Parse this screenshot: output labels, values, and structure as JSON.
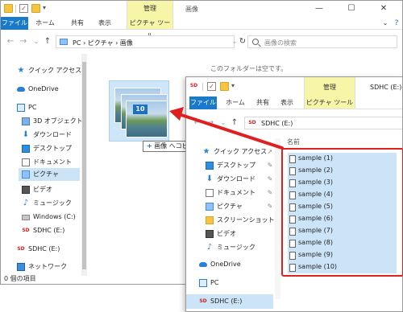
{
  "back_window": {
    "title": "画像",
    "manage_tab": "管理",
    "ribbon_tabs": [
      "ファイル",
      "ホーム",
      "共有",
      "表示",
      "ピクチャ ツール"
    ],
    "address": "PC › ピクチャ › 画像",
    "search_placeholder": "画像の検索",
    "empty_message": "このフォルダーは空です。",
    "status": "0 個の項目",
    "nav": [
      {
        "label": "クイック アクセス",
        "icon": "star-icon"
      },
      {
        "label": "OneDrive",
        "icon": "cloud-icon"
      },
      {
        "label": "PC",
        "icon": "pc-icon"
      },
      {
        "label": "3D オブジェクト",
        "icon": "cube-icon"
      },
      {
        "label": "ダウンロード",
        "icon": "download-icon"
      },
      {
        "label": "デスクトップ",
        "icon": "desktop-icon"
      },
      {
        "label": "ドキュメント",
        "icon": "document-icon"
      },
      {
        "label": "ピクチャ",
        "icon": "pictures-icon"
      },
      {
        "label": "ビデオ",
        "icon": "video-icon"
      },
      {
        "label": "ミュージック",
        "icon": "music-icon"
      },
      {
        "label": "Windows (C:)",
        "icon": "drive-icon"
      },
      {
        "label": "SDHC (E:)",
        "icon": "sd-card-icon"
      },
      {
        "label": "SDHC (E:)",
        "icon": "sd-card-icon"
      },
      {
        "label": "ネットワーク",
        "icon": "network-icon"
      }
    ]
  },
  "drag": {
    "count": "10",
    "tooltip": "画像 へコピー",
    "tooltip_icon": "plus-icon"
  },
  "front_window": {
    "title": "SDHC (E:)",
    "manage_tab": "管理",
    "ribbon_tabs": [
      "ファイル",
      "ホーム",
      "共有",
      "表示",
      "ピクチャ ツール"
    ],
    "address": "SDHC (E:)",
    "column_name": "名前",
    "nav": [
      {
        "label": "クイック アクセス",
        "icon": "star-icon"
      },
      {
        "label": "デスクトップ",
        "icon": "desktop-icon"
      },
      {
        "label": "ダウンロード",
        "icon": "download-icon"
      },
      {
        "label": "ドキュメント",
        "icon": "document-icon"
      },
      {
        "label": "ピクチャ",
        "icon": "pictures-icon"
      },
      {
        "label": "スクリーンショット",
        "icon": "folder-icon"
      },
      {
        "label": "ビデオ",
        "icon": "video-icon"
      },
      {
        "label": "ミュージック",
        "icon": "music-icon"
      },
      {
        "label": "OneDrive",
        "icon": "cloud-icon"
      },
      {
        "label": "PC",
        "icon": "pc-icon"
      },
      {
        "label": "SDHC (E:)",
        "icon": "sd-card-icon"
      }
    ],
    "files": [
      "sample (1)",
      "sample (2)",
      "sample (3)",
      "sample (4)",
      "sample (5)",
      "sample (6)",
      "sample (7)",
      "sample (8)",
      "sample (9)",
      "sample (10)"
    ]
  },
  "colors": {
    "accent": "#1979ca",
    "selection": "#cce4f7",
    "highlight_frame": "#e02020",
    "manage_tab": "#f6f5a8"
  }
}
